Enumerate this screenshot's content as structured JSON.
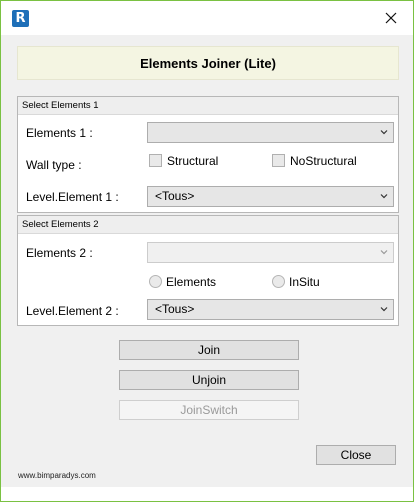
{
  "window": {
    "app_icon_letter": "R",
    "accent_color": "#7ac142",
    "close_icon": "close-icon"
  },
  "header": {
    "title": "Elements Joiner (Lite)"
  },
  "group1": {
    "header": "Select Elements 1",
    "elements_label": "Elements 1 :",
    "elements_value": "",
    "wall_type_label": "Wall type :",
    "structural_label": "Structural",
    "structural_checked": false,
    "nostructural_label": "NoStructural",
    "nostructural_checked": false,
    "level_label": "Level.Element 1 :",
    "level_value": "<Tous>"
  },
  "group2": {
    "header": "Select Elements 2",
    "elements_label": "Elements 2 :",
    "elements_value": "",
    "radio_elements_label": "Elements",
    "radio_elements_selected": false,
    "radio_insitu_label": "InSitu",
    "radio_insitu_selected": false,
    "level_label": "Level.Element 2 :",
    "level_value": "<Tous>"
  },
  "actions": {
    "join_label": "Join",
    "unjoin_label": "Unjoin",
    "joinswitch_label": "JoinSwitch",
    "joinswitch_enabled": false,
    "close_label": "Close"
  },
  "footer": {
    "website": "www.bimparadys.com"
  }
}
